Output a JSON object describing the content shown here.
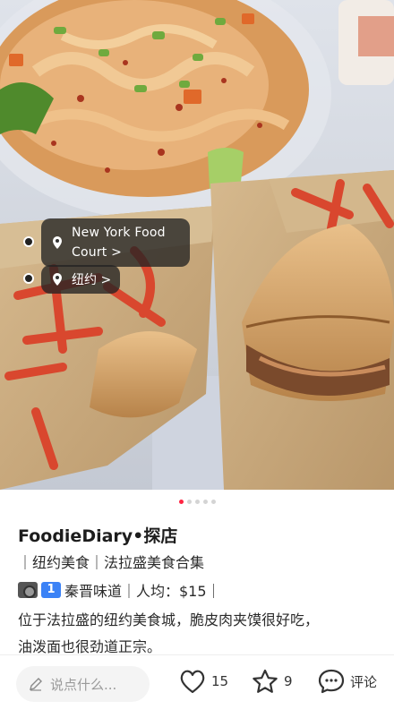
{
  "photo": {
    "tags": [
      {
        "label": "New York Food Court",
        "chevron": ">"
      },
      {
        "label": "纽约",
        "chevron": ">"
      }
    ]
  },
  "pager": {
    "count": 5,
    "active_index": 0
  },
  "post": {
    "author": "FoodieDiary•探店",
    "line1": "｜纽约美食｜法拉盛美食合集",
    "line2_emojis": [
      "camera-icon",
      "keycap-one-icon"
    ],
    "line2": "秦晋味道｜人均：$15｜",
    "line3": "位于法拉盛的纽约美食城，脆皮肉夹馍很好吃，",
    "line4": "油泼面也很劲道正宗。"
  },
  "bottom_bar": {
    "comment_placeholder": "说点什么...",
    "likes": "15",
    "collects": "9",
    "comment_label": "评论"
  },
  "colors": {
    "accent": "#ff2442",
    "bag_red": "#d9472e",
    "bag_paper": "#c9a97c"
  }
}
